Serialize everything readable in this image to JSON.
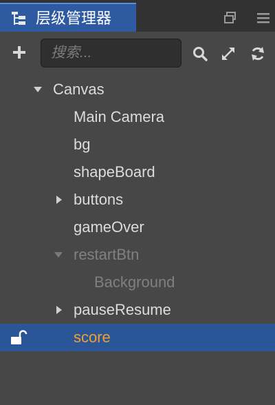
{
  "tab": {
    "title": "层级管理器"
  },
  "toolbar": {
    "search_placeholder": "搜索..."
  },
  "tree": [
    {
      "label": "Canvas",
      "expanded": true,
      "active": true,
      "selected": false
    },
    {
      "label": "Main Camera",
      "active": true,
      "selected": false
    },
    {
      "label": "bg",
      "active": true,
      "selected": false
    },
    {
      "label": "shapeBoard",
      "active": true,
      "selected": false
    },
    {
      "label": "buttons",
      "expanded": false,
      "active": true,
      "selected": false
    },
    {
      "label": "gameOver",
      "active": true,
      "selected": false
    },
    {
      "label": "restartBtn",
      "expanded": true,
      "active": false,
      "selected": false
    },
    {
      "label": "Background",
      "active": false,
      "selected": false
    },
    {
      "label": "pauseResume",
      "expanded": false,
      "active": true,
      "selected": false
    },
    {
      "label": "score",
      "active": true,
      "selected": true,
      "unlocked": true
    }
  ],
  "colors": {
    "accent": "#2d5aa0",
    "selection": "#2a5596",
    "selected_text": "#f0a030",
    "inactive_text": "#808080"
  }
}
